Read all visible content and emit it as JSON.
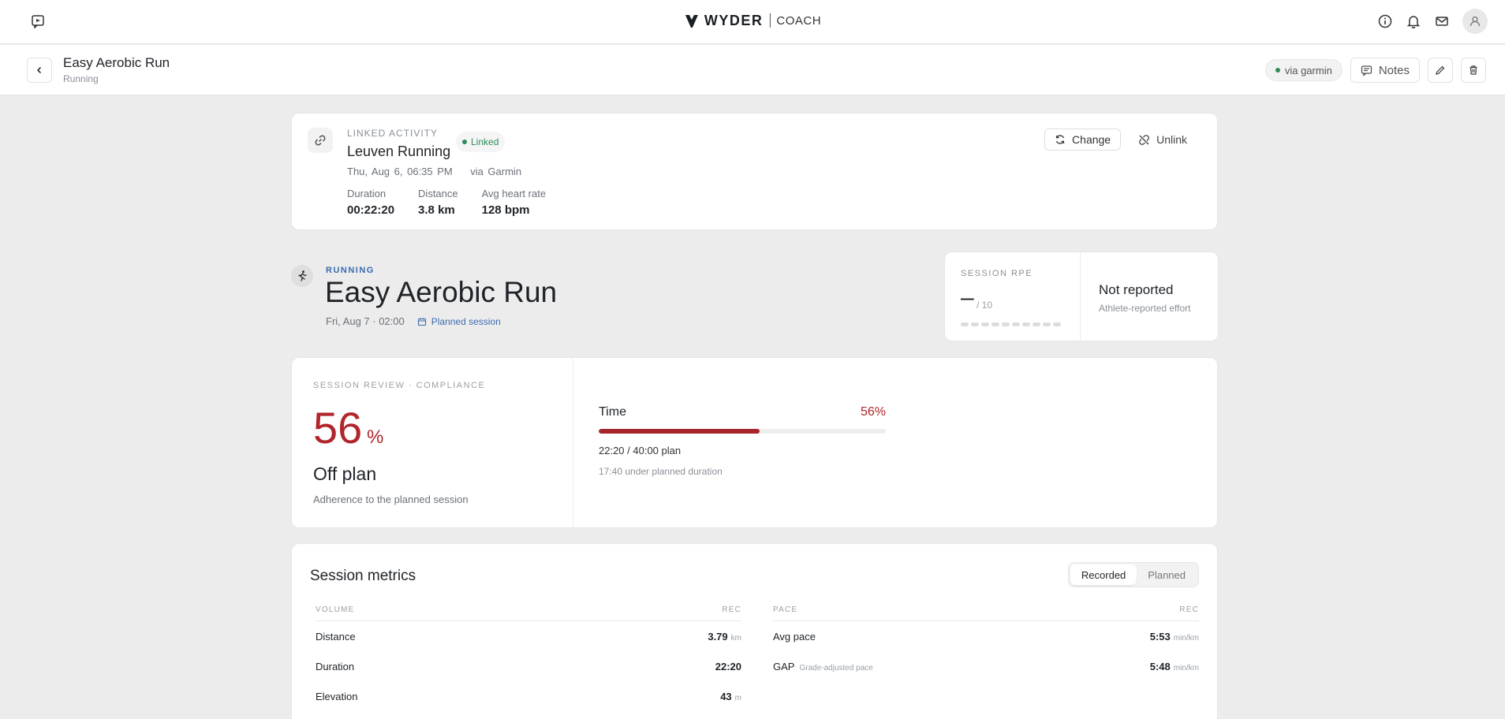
{
  "brand": {
    "name": "WYDER",
    "sub": "COACH"
  },
  "header": {
    "title": "Easy Aerobic Run",
    "subtitle": "Running",
    "source_label": "via garmin",
    "notes_label": "Notes"
  },
  "linked": {
    "label": "LINKED ACTIVITY",
    "name": "Leuven Running",
    "badge": "Linked",
    "date": "Thu, Aug 6, 06:35 PM",
    "source": "via Garmin",
    "change_label": "Change",
    "unlink_label": "Unlink",
    "stats": [
      {
        "label": "Duration",
        "value": "00:22:20"
      },
      {
        "label": "Distance",
        "value": "3.8 km"
      },
      {
        "label": "Avg heart rate",
        "value": "128 bpm"
      }
    ]
  },
  "session": {
    "sport": "RUNNING",
    "title": "Easy Aerobic Run",
    "date": "Fri, Aug 7 · 02:00",
    "planned_label": "Planned session"
  },
  "rpe": {
    "label": "SESSION RPE",
    "value": "–",
    "max": "/ 10",
    "status": "Not reported",
    "desc": "Athlete-reported effort",
    "scale_steps": 10,
    "level": 0
  },
  "compliance": {
    "label": "SESSION REVIEW · COMPLIANCE",
    "value": "56",
    "unit": "%",
    "status": "Off plan",
    "desc": "Adherence to the planned session",
    "time": {
      "label": "Time",
      "percent_label": "56%",
      "fraction": 0.56,
      "plan": "22:20 / 40:00 plan",
      "note": "17:40 under planned duration"
    }
  },
  "metrics": {
    "title": "Session metrics",
    "toggle": [
      "Recorded",
      "Planned"
    ],
    "volume": {
      "header": "VOLUME",
      "col": "REC",
      "rows": [
        {
          "label": "Distance",
          "value": "3.79",
          "unit": "km"
        },
        {
          "label": "Duration",
          "value": "22:20",
          "unit": ""
        },
        {
          "label": "Elevation",
          "value": "43",
          "unit": "m"
        }
      ]
    },
    "pace": {
      "header": "PACE",
      "col": "REC",
      "rows": [
        {
          "label": "Avg pace",
          "note": "",
          "value": "5:53",
          "unit": "min/km"
        },
        {
          "label": "GAP",
          "note": "Grade-adjusted pace",
          "value": "5:48",
          "unit": "min/km"
        }
      ]
    }
  },
  "colors": {
    "accent_red": "#b0262b",
    "accent_blue": "#3a6bb0",
    "linked_green": "#2e8b57"
  }
}
